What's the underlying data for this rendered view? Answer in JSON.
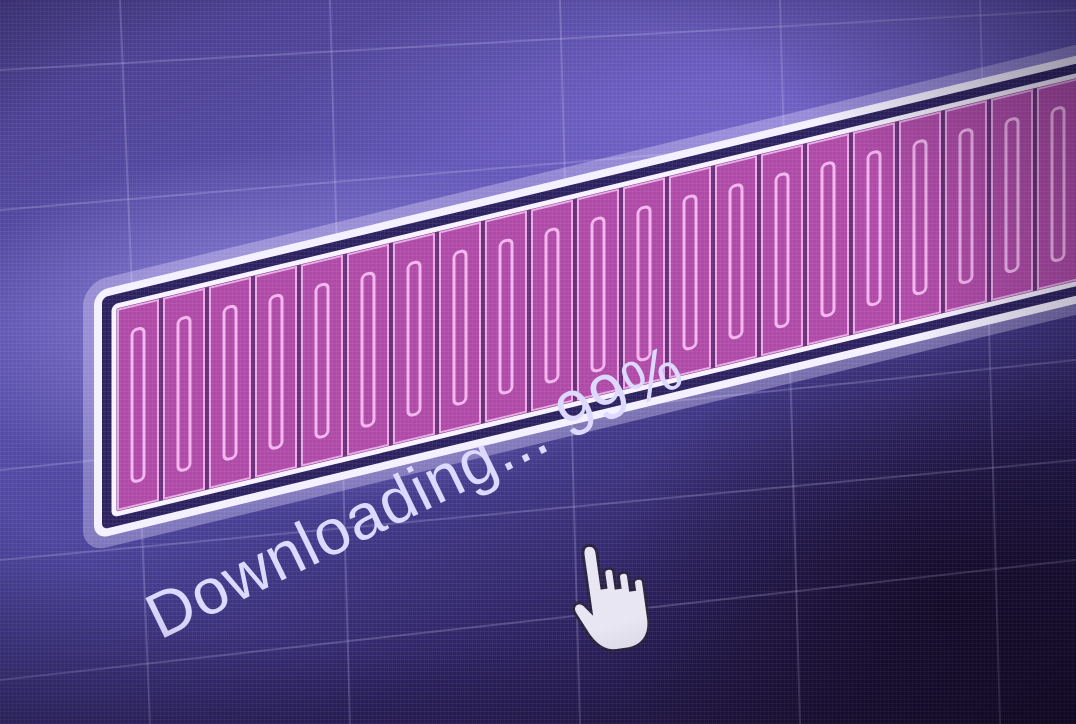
{
  "progress": {
    "label": "Downloading... 99%",
    "percent": 99
  },
  "colors": {
    "background": "#4e46a0",
    "bar_fill": "#b04aa8",
    "bar_segment_glow": "#f2b5ee",
    "bar_frame": "#f4f0ff",
    "text": "#dcd8ff"
  },
  "icons": {
    "cursor": "hand-pointer-icon"
  }
}
